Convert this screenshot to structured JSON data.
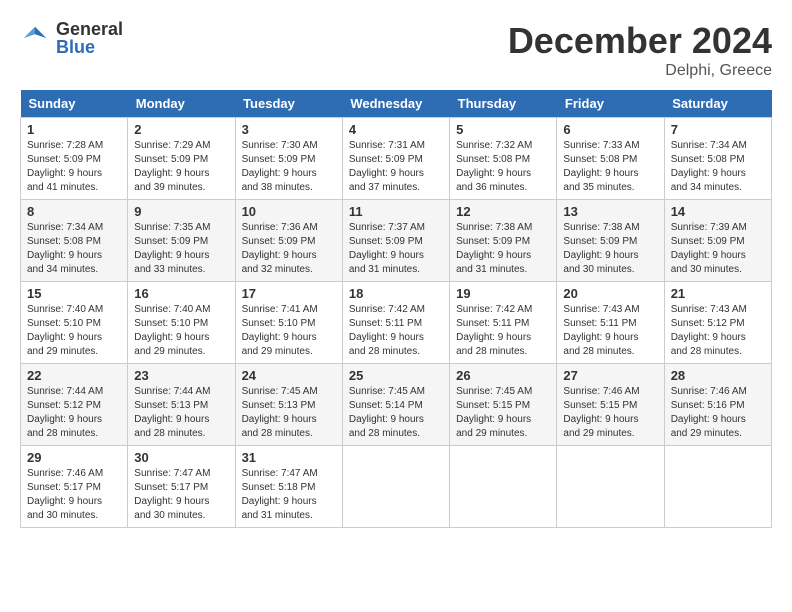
{
  "header": {
    "logo_general": "General",
    "logo_blue": "Blue",
    "title": "December 2024",
    "location": "Delphi, Greece"
  },
  "columns": [
    "Sunday",
    "Monday",
    "Tuesday",
    "Wednesday",
    "Thursday",
    "Friday",
    "Saturday"
  ],
  "weeks": [
    [
      {
        "day": "1",
        "sunrise": "7:28 AM",
        "sunset": "5:09 PM",
        "daylight": "9 hours and 41 minutes."
      },
      {
        "day": "2",
        "sunrise": "7:29 AM",
        "sunset": "5:09 PM",
        "daylight": "9 hours and 39 minutes."
      },
      {
        "day": "3",
        "sunrise": "7:30 AM",
        "sunset": "5:09 PM",
        "daylight": "9 hours and 38 minutes."
      },
      {
        "day": "4",
        "sunrise": "7:31 AM",
        "sunset": "5:09 PM",
        "daylight": "9 hours and 37 minutes."
      },
      {
        "day": "5",
        "sunrise": "7:32 AM",
        "sunset": "5:08 PM",
        "daylight": "9 hours and 36 minutes."
      },
      {
        "day": "6",
        "sunrise": "7:33 AM",
        "sunset": "5:08 PM",
        "daylight": "9 hours and 35 minutes."
      },
      {
        "day": "7",
        "sunrise": "7:34 AM",
        "sunset": "5:08 PM",
        "daylight": "9 hours and 34 minutes."
      }
    ],
    [
      {
        "day": "8",
        "sunrise": "7:34 AM",
        "sunset": "5:08 PM",
        "daylight": "9 hours and 34 minutes."
      },
      {
        "day": "9",
        "sunrise": "7:35 AM",
        "sunset": "5:09 PM",
        "daylight": "9 hours and 33 minutes."
      },
      {
        "day": "10",
        "sunrise": "7:36 AM",
        "sunset": "5:09 PM",
        "daylight": "9 hours and 32 minutes."
      },
      {
        "day": "11",
        "sunrise": "7:37 AM",
        "sunset": "5:09 PM",
        "daylight": "9 hours and 31 minutes."
      },
      {
        "day": "12",
        "sunrise": "7:38 AM",
        "sunset": "5:09 PM",
        "daylight": "9 hours and 31 minutes."
      },
      {
        "day": "13",
        "sunrise": "7:38 AM",
        "sunset": "5:09 PM",
        "daylight": "9 hours and 30 minutes."
      },
      {
        "day": "14",
        "sunrise": "7:39 AM",
        "sunset": "5:09 PM",
        "daylight": "9 hours and 30 minutes."
      }
    ],
    [
      {
        "day": "15",
        "sunrise": "7:40 AM",
        "sunset": "5:10 PM",
        "daylight": "9 hours and 29 minutes."
      },
      {
        "day": "16",
        "sunrise": "7:40 AM",
        "sunset": "5:10 PM",
        "daylight": "9 hours and 29 minutes."
      },
      {
        "day": "17",
        "sunrise": "7:41 AM",
        "sunset": "5:10 PM",
        "daylight": "9 hours and 29 minutes."
      },
      {
        "day": "18",
        "sunrise": "7:42 AM",
        "sunset": "5:11 PM",
        "daylight": "9 hours and 28 minutes."
      },
      {
        "day": "19",
        "sunrise": "7:42 AM",
        "sunset": "5:11 PM",
        "daylight": "9 hours and 28 minutes."
      },
      {
        "day": "20",
        "sunrise": "7:43 AM",
        "sunset": "5:11 PM",
        "daylight": "9 hours and 28 minutes."
      },
      {
        "day": "21",
        "sunrise": "7:43 AM",
        "sunset": "5:12 PM",
        "daylight": "9 hours and 28 minutes."
      }
    ],
    [
      {
        "day": "22",
        "sunrise": "7:44 AM",
        "sunset": "5:12 PM",
        "daylight": "9 hours and 28 minutes."
      },
      {
        "day": "23",
        "sunrise": "7:44 AM",
        "sunset": "5:13 PM",
        "daylight": "9 hours and 28 minutes."
      },
      {
        "day": "24",
        "sunrise": "7:45 AM",
        "sunset": "5:13 PM",
        "daylight": "9 hours and 28 minutes."
      },
      {
        "day": "25",
        "sunrise": "7:45 AM",
        "sunset": "5:14 PM",
        "daylight": "9 hours and 28 minutes."
      },
      {
        "day": "26",
        "sunrise": "7:45 AM",
        "sunset": "5:15 PM",
        "daylight": "9 hours and 29 minutes."
      },
      {
        "day": "27",
        "sunrise": "7:46 AM",
        "sunset": "5:15 PM",
        "daylight": "9 hours and 29 minutes."
      },
      {
        "day": "28",
        "sunrise": "7:46 AM",
        "sunset": "5:16 PM",
        "daylight": "9 hours and 29 minutes."
      }
    ],
    [
      {
        "day": "29",
        "sunrise": "7:46 AM",
        "sunset": "5:17 PM",
        "daylight": "9 hours and 30 minutes."
      },
      {
        "day": "30",
        "sunrise": "7:47 AM",
        "sunset": "5:17 PM",
        "daylight": "9 hours and 30 minutes."
      },
      {
        "day": "31",
        "sunrise": "7:47 AM",
        "sunset": "5:18 PM",
        "daylight": "9 hours and 31 minutes."
      },
      null,
      null,
      null,
      null
    ]
  ]
}
